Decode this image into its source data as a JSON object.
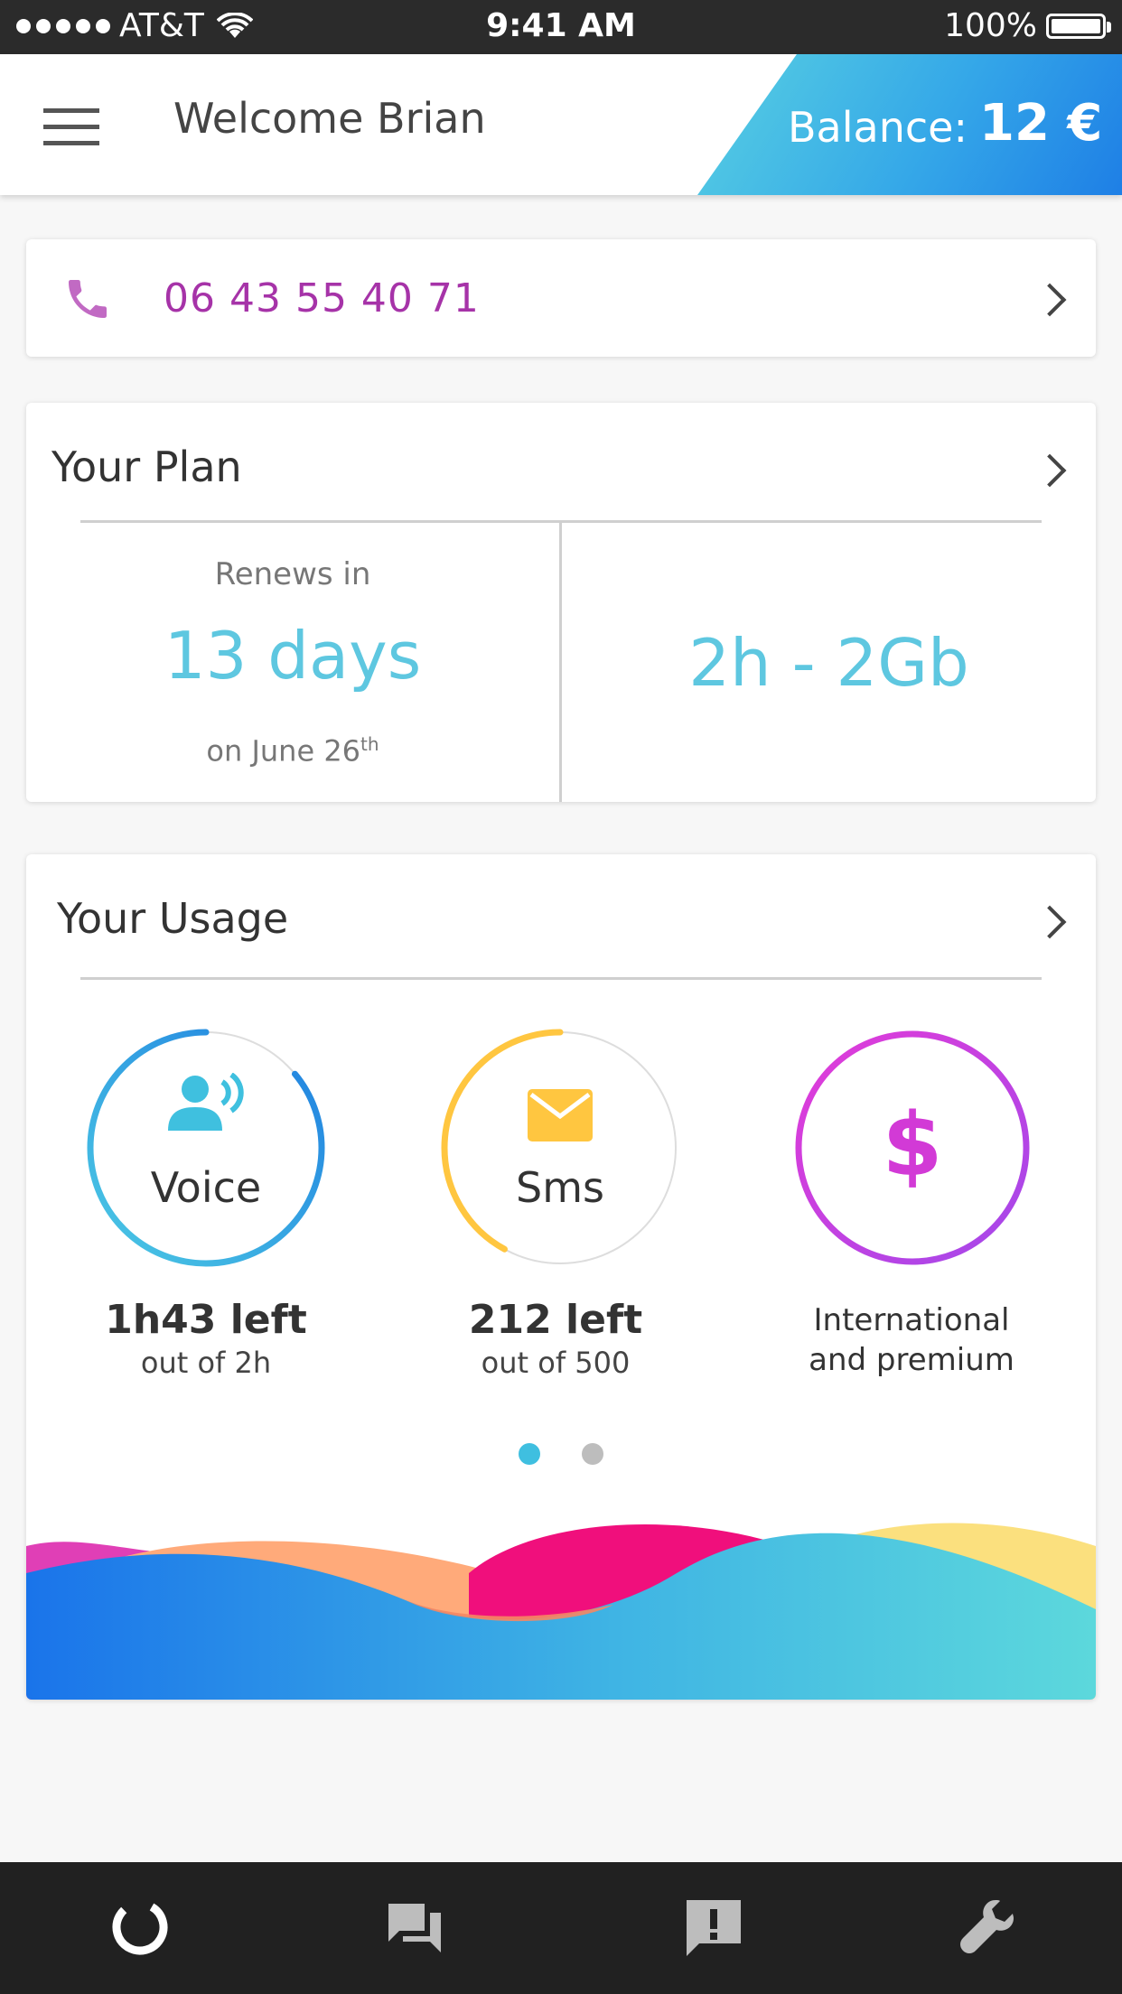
{
  "status_bar": {
    "carrier": "AT&T",
    "time": "9:41 AM",
    "battery": "100%"
  },
  "header": {
    "welcome": "Welcome Brian",
    "balance_label": "Balance:",
    "balance_value": "12 €"
  },
  "phone": {
    "number": "06 43 55 40 71"
  },
  "plan": {
    "title": "Your Plan",
    "renews_label": "Renews in",
    "renews_days": "13 days",
    "renews_date": "on June 26",
    "renews_date_suffix": "th",
    "allowance": "2h - 2Gb"
  },
  "usage": {
    "title": "Your Usage",
    "voice": {
      "label": "Voice",
      "main": "1h43 left",
      "sub": "out of 2h",
      "fraction_left": 0.86
    },
    "sms": {
      "label": "Sms",
      "main": "212 left",
      "sub": "out of 500",
      "fraction_left": 0.42
    },
    "international": {
      "symbol": "$",
      "line1": "International",
      "line2": "and premium"
    },
    "pager": {
      "count": 2,
      "active": 0
    }
  },
  "tabs": [
    "dashboard-icon",
    "messages-icon",
    "alert-icon",
    "settings-wrench-icon"
  ],
  "colors": {
    "accent_blue": "#5ec7e0",
    "phone_purple": "#a633a8",
    "voice_gradient": [
      "#4cc9e4",
      "#1f7fe0"
    ],
    "sms_color": "#ffc640",
    "intl_gradient": [
      "#e33bd8",
      "#a348ea"
    ],
    "tab_bar": "#212121"
  }
}
